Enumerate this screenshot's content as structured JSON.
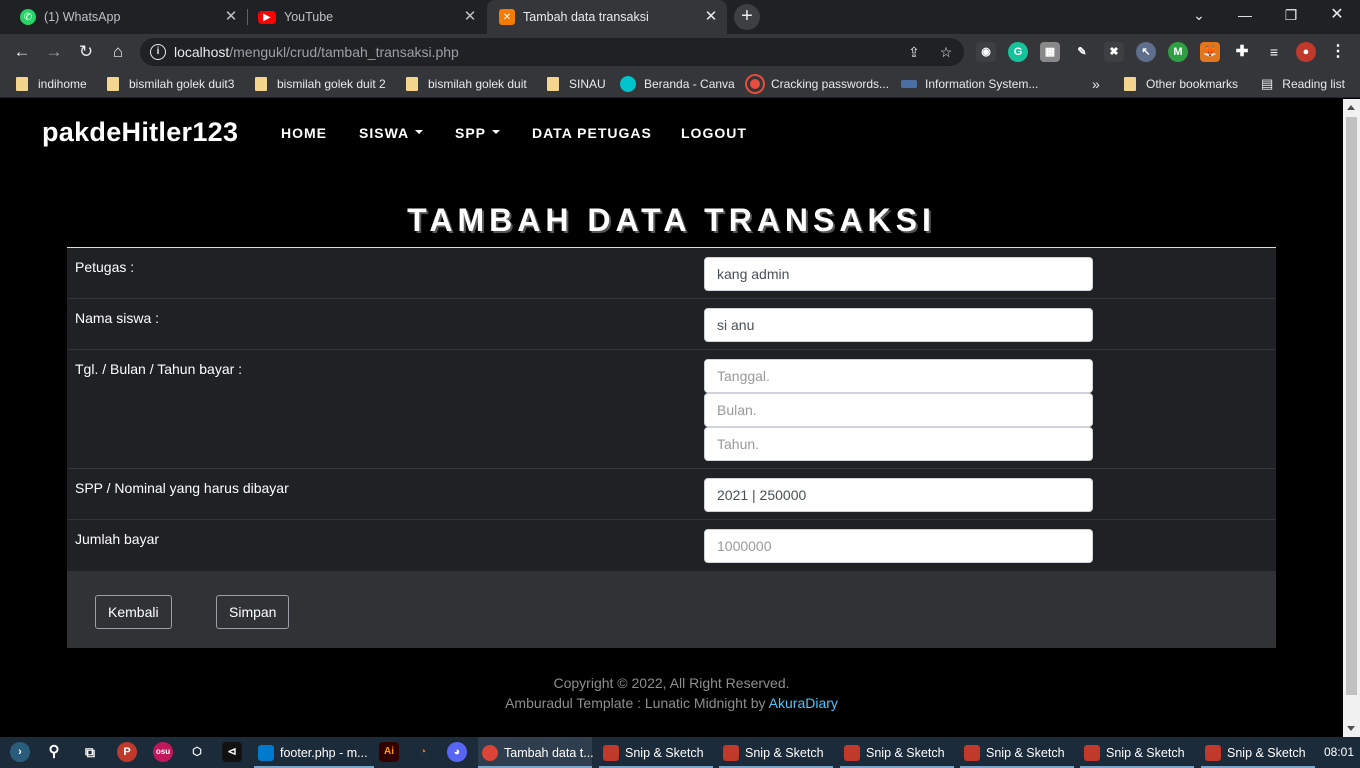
{
  "browser": {
    "tabs": [
      {
        "title": "(1) WhatsApp",
        "icon": "whatsapp-icon",
        "color": "#25d366"
      },
      {
        "title": "YouTube",
        "icon": "youtube-icon",
        "color": "#ff0000"
      },
      {
        "title": "Tambah data transaksi",
        "icon": "xampp-icon",
        "color": "#f57c00",
        "active": true
      }
    ],
    "new_tab_label": "+",
    "url_host": "localhost",
    "url_path": "/mengukl/crud/tambah_transaksi.php",
    "bookmarks": [
      {
        "label": "indihome",
        "icon": "folder-icon"
      },
      {
        "label": "bismilah golek duit3",
        "icon": "folder-icon"
      },
      {
        "label": "bismilah golek duit 2",
        "icon": "folder-icon"
      },
      {
        "label": "bismilah golek duit",
        "icon": "folder-icon"
      },
      {
        "label": "SINAU",
        "icon": "folder-icon"
      },
      {
        "label": "Beranda - Canva",
        "icon": "canva-icon"
      },
      {
        "label": "Cracking passwords...",
        "icon": "target-icon"
      },
      {
        "label": "Information System...",
        "icon": "site-icon"
      }
    ],
    "bookmarks_overflow": "»",
    "other_bookmarks": "Other bookmarks",
    "reading_list": "Reading list"
  },
  "site": {
    "brand": "pakdeHitler123",
    "nav": [
      {
        "label": "HOME",
        "dropdown": false
      },
      {
        "label": "SISWA",
        "dropdown": true
      },
      {
        "label": "SPP",
        "dropdown": true
      },
      {
        "label": "DATA PETUGAS",
        "dropdown": false
      },
      {
        "label": "LOGOUT",
        "dropdown": false
      }
    ]
  },
  "form": {
    "title": "TAMBAH DATA TRANSAKSI",
    "petugas_label": "Petugas :",
    "petugas_value": "kang admin",
    "nama_label": "Nama siswa :",
    "nama_value": "si anu",
    "tanggal_label": "Tgl. / Bulan / Tahun bayar :",
    "tanggal_placeholder": "Tanggal.",
    "bulan_placeholder": "Bulan.",
    "tahun_placeholder": "Tahun.",
    "spp_label": "SPP / Nominal yang harus dibayar",
    "spp_value": "2021 | 250000",
    "jumlah_label": "Jumlah bayar",
    "jumlah_placeholder": "1000000",
    "back_button": "Kembali",
    "save_button": "Simpan"
  },
  "footer": {
    "copyright": "Copyright © 2022, All Right Reserved.",
    "credit_text": "Amburadul Template : Lunatic Midnight by",
    "credit_link": "AkuraDiary"
  },
  "taskbar": {
    "apps": [
      {
        "label": "footer.php - m...",
        "icon": "vscode-icon"
      },
      {
        "label": "Tambah data t...",
        "icon": "chrome-icon",
        "active": true
      },
      {
        "label": "Snip & Sketch",
        "icon": "snip-sketch-icon"
      },
      {
        "label": "Snip & Sketch",
        "icon": "snip-sketch-icon"
      },
      {
        "label": "Snip & Sketch",
        "icon": "snip-sketch-icon"
      },
      {
        "label": "Snip & Sketch",
        "icon": "snip-sketch-icon"
      },
      {
        "label": "Snip & Sketch",
        "icon": "snip-sketch-icon"
      },
      {
        "label": "Snip & Sketch",
        "icon": "snip-sketch-icon"
      }
    ],
    "clock": "08:01"
  }
}
